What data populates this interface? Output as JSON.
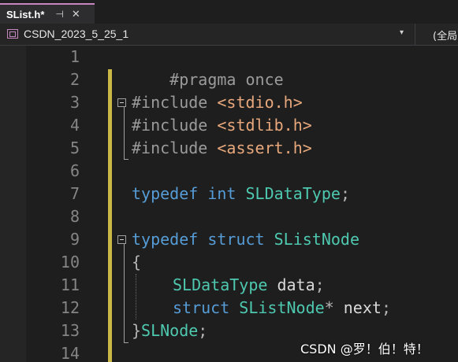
{
  "tab": {
    "title": "SList.h*",
    "pin_glyph": "⊣",
    "close_glyph": "✕"
  },
  "navbar": {
    "project": "CSDN_2023_5_25_1",
    "caret_glyph": "▾",
    "scope": "(全局"
  },
  "editor": {
    "line_numbers": [
      "1",
      "2",
      "3",
      "4",
      "5",
      "6",
      "7",
      "8",
      "9",
      "10",
      "11",
      "12",
      "13",
      "14"
    ],
    "code": {
      "l1": {
        "directive": "#pragma once"
      },
      "l3": {
        "directive": "#include ",
        "header": "<stdio.h>"
      },
      "l4": {
        "directive": "#include ",
        "header": "<stdlib.h>"
      },
      "l5": {
        "directive": "#include ",
        "header": "<assert.h>"
      },
      "l7": {
        "kw1": "typedef",
        "kw2": "int",
        "type": "SLDataType",
        "punct": ";"
      },
      "l9": {
        "kw1": "typedef",
        "kw2": "struct",
        "type": "SListNode"
      },
      "l10": {
        "brace": "{"
      },
      "l11": {
        "type": "SLDataType",
        "ident": "data",
        "punct": ";"
      },
      "l12": {
        "kw": "struct",
        "type": "SListNode",
        "ptr": "*",
        "ident": "next",
        "punct": ";"
      },
      "l13": {
        "brace": "}",
        "type": "SLNode",
        "punct": ";"
      }
    }
  },
  "watermark": "CSDN @罗！伯！特！",
  "colors": {
    "keyword": "#569cd6",
    "type": "#4ec9b0",
    "string": "#e8a87c",
    "preprocessor": "#9b9b9b",
    "change_bar": "#e8d44d",
    "background": "#1e1e1e"
  }
}
